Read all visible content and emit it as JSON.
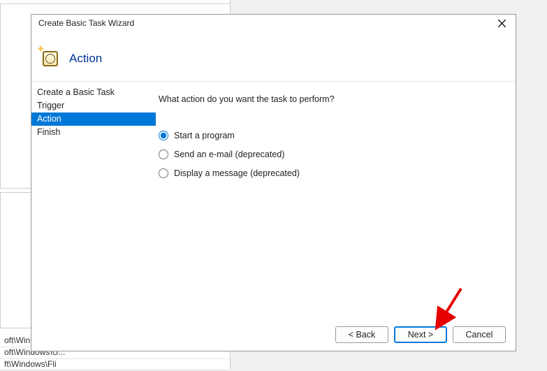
{
  "background": {
    "row1": "oft\\Windo",
    "row2": "oft\\Windows\\U...",
    "row3": "ft\\Windows\\Fli"
  },
  "dialog": {
    "title": "Create Basic Task Wizard",
    "headerTitle": "Action",
    "sidebar": {
      "items": [
        {
          "label": "Create a Basic Task",
          "selected": false
        },
        {
          "label": "Trigger",
          "selected": false
        },
        {
          "label": "Action",
          "selected": true
        },
        {
          "label": "Finish",
          "selected": false
        }
      ]
    },
    "content": {
      "prompt": "What action do you want the task to perform?",
      "options": [
        {
          "label": "Start a program",
          "checked": true
        },
        {
          "label": "Send an e-mail (deprecated)",
          "checked": false
        },
        {
          "label": "Display a message (deprecated)",
          "checked": false
        }
      ]
    },
    "buttons": {
      "back": "< Back",
      "next": "Next >",
      "cancel": "Cancel"
    }
  }
}
